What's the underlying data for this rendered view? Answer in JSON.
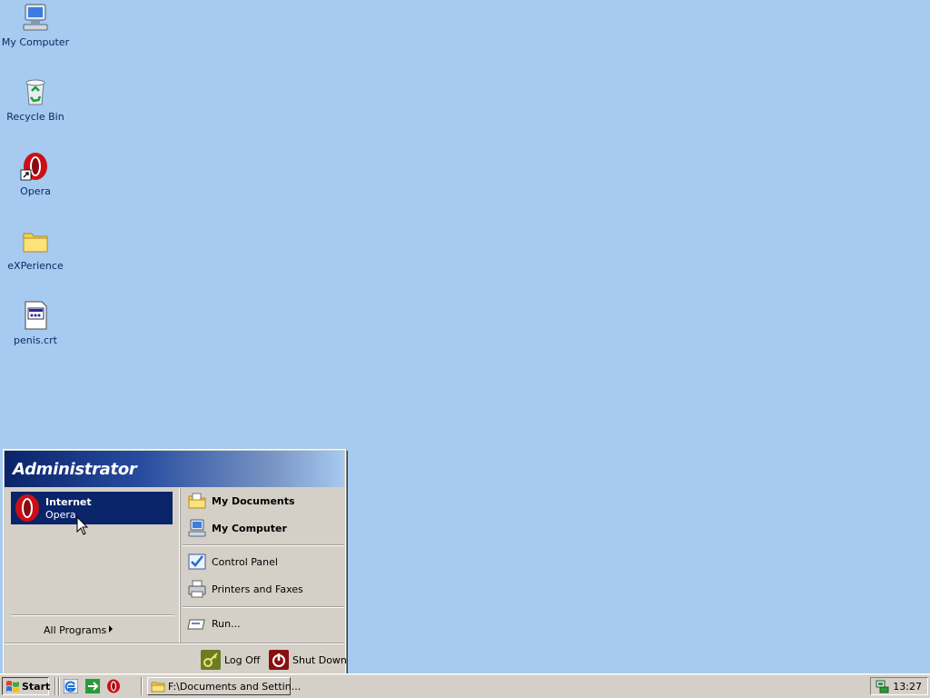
{
  "desktop": {
    "icons": [
      {
        "label": "My Computer",
        "icon": "my-computer-icon"
      },
      {
        "label": "Recycle Bin",
        "icon": "recycle-bin-icon"
      },
      {
        "label": "Opera",
        "icon": "opera-icon"
      },
      {
        "label": "eXPerience",
        "icon": "folder-icon"
      },
      {
        "label": "penis.crt",
        "icon": "certificate-file-icon"
      }
    ]
  },
  "start_menu": {
    "user": "Administrator",
    "pinned": {
      "title": "Internet",
      "subtitle": "Opera",
      "icon": "opera-icon"
    },
    "all_programs": "All Programs",
    "right": {
      "my_documents": "My Documents",
      "my_computer": "My Computer",
      "control_panel": "Control Panel",
      "printers": "Printers and Faxes",
      "run": "Run..."
    },
    "footer": {
      "log_off": "Log Off",
      "shut_down": "Shut Down"
    }
  },
  "taskbar": {
    "start_label": "Start",
    "task": "F:\\Documents and Settin...",
    "clock": "13:27",
    "quick_launch": [
      "ie-icon",
      "show-desktop-icon",
      "opera-icon"
    ]
  },
  "colors": {
    "desktop": "#a6caf0",
    "selection": "#0a246a",
    "face": "#d4d0c8"
  }
}
